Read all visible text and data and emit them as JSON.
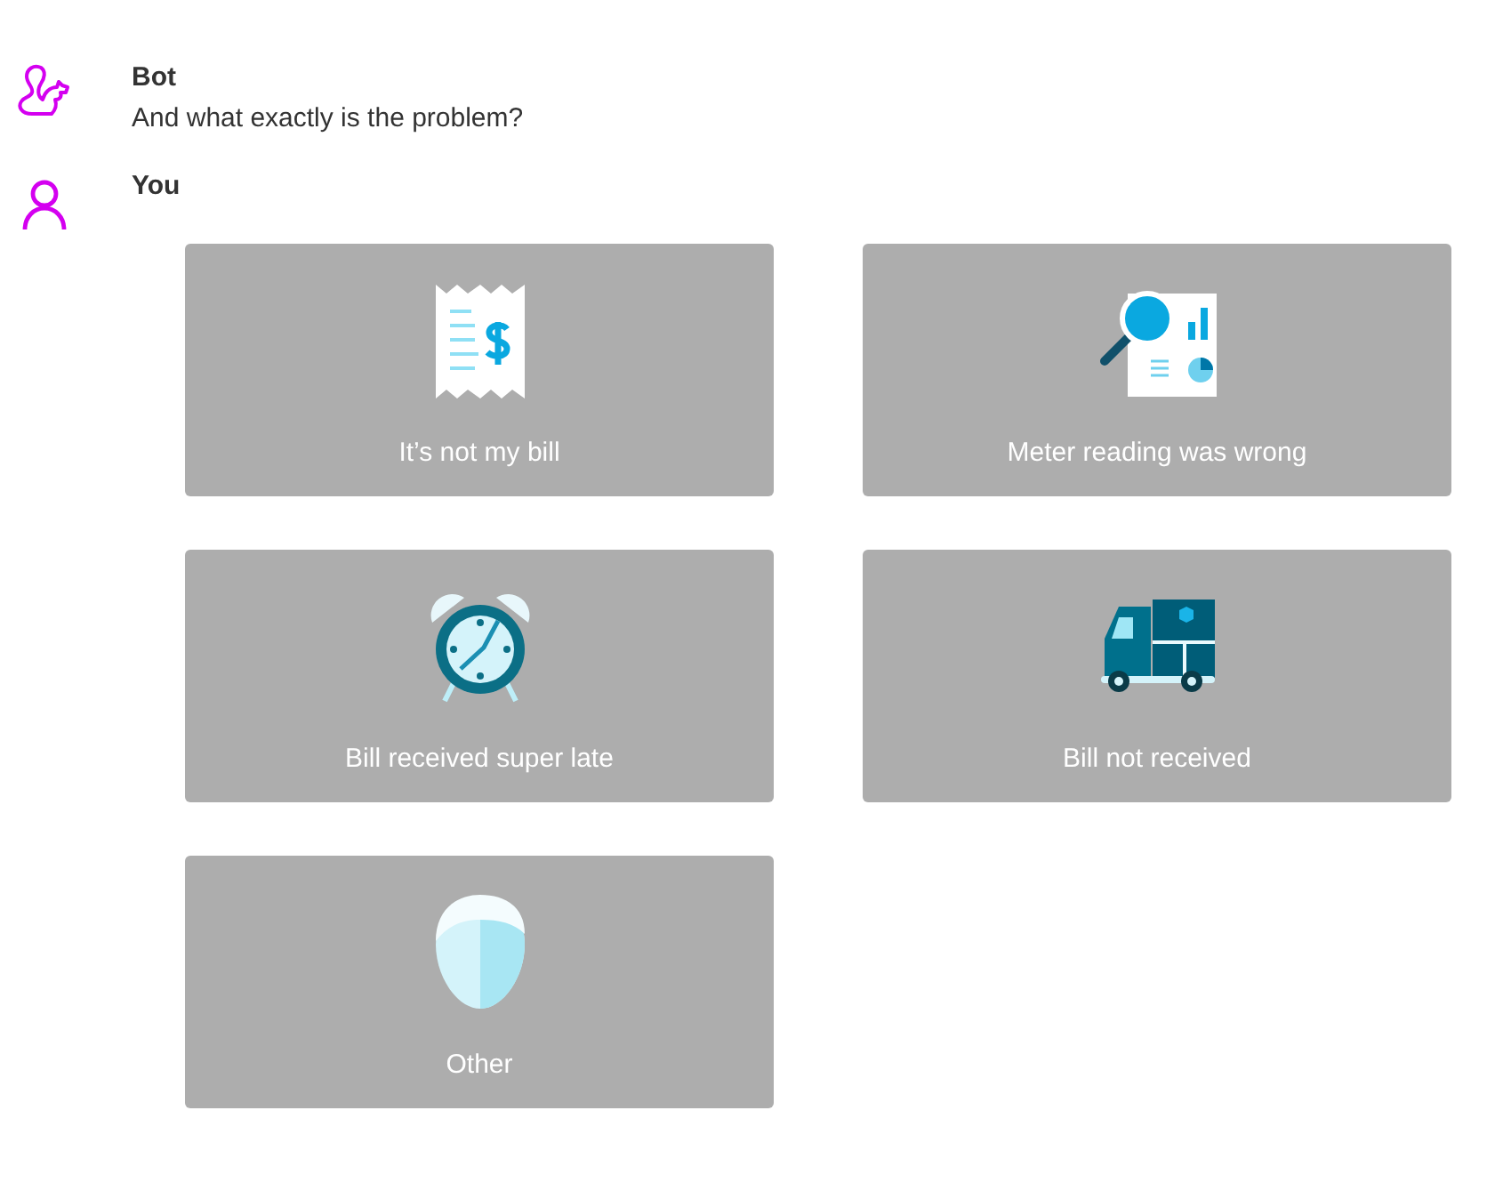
{
  "messages": [
    {
      "sender": "Bot",
      "kind": "bot",
      "text": "And what exactly is the problem?"
    },
    {
      "sender": "You",
      "kind": "user"
    }
  ],
  "options": [
    {
      "label": "It’s not my bill",
      "kind": "receipt"
    },
    {
      "label": "Meter reading was wrong",
      "kind": "report"
    },
    {
      "label": "Bill received super late",
      "kind": "clock"
    },
    {
      "label": "Bill not received",
      "kind": "truck"
    },
    {
      "label": "Other",
      "kind": "head"
    }
  ]
}
